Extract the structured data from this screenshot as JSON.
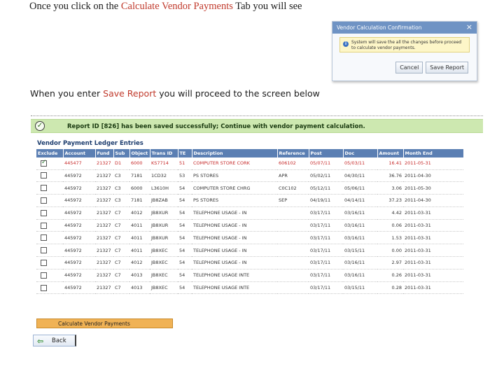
{
  "intro": {
    "prefix": "Once you click on the ",
    "highlight": "Calculate Vendor Payments",
    "suffix": " Tab you will see"
  },
  "dialog": {
    "title": "Vendor Calculation Confirmation",
    "close": "×",
    "message": "System will save the all the changes before proceed to calculate vendor payments.",
    "cancel_label": "Cancel",
    "save_label": "Save Report"
  },
  "intro2": {
    "prefix": "When you enter ",
    "highlight": "Save Report",
    "suffix": " you will proceed to the  screen below"
  },
  "success": {
    "text": "Report ID [826] has been saved successfully; Continue with vendor payment calculation."
  },
  "ledger": {
    "title": "Vendor Payment Ledger Entries",
    "columns": [
      "Exclude",
      "Account",
      "Fund",
      "Sub",
      "Object",
      "Trans ID",
      "TE",
      "Description",
      "Reference",
      "Post",
      "Doc",
      "Amount",
      "Month End"
    ],
    "rows": [
      {
        "checked": true,
        "account": "445477",
        "fund": "21327",
        "sub": "D1",
        "object": "6000",
        "trans_id": "KS7714",
        "te": "51",
        "description": "COMPUTER STORE CORK",
        "reference": "606102",
        "post": "05/07/11",
        "doc": "05/03/11",
        "amount": "16.41",
        "month_end": "2011-05-31"
      },
      {
        "checked": false,
        "account": "445972",
        "fund": "21327",
        "sub": "C3",
        "object": "7181",
        "trans_id": "1CD32",
        "te": "53",
        "description": "PS STORES",
        "reference": "APR",
        "post": "05/02/11",
        "doc": "04/30/11",
        "amount": "36.76",
        "month_end": "2011-04-30"
      },
      {
        "checked": false,
        "account": "445972",
        "fund": "21327",
        "sub": "C3",
        "object": "6000",
        "trans_id": "L3610H",
        "te": "54",
        "description": "COMPUTER STORE CHRG",
        "reference": "C0C102",
        "post": "05/12/11",
        "doc": "05/06/11",
        "amount": "3.06",
        "month_end": "2011-05-30"
      },
      {
        "checked": false,
        "account": "445972",
        "fund": "21327",
        "sub": "C3",
        "object": "7181",
        "trans_id": "JB8ZAB",
        "te": "54",
        "description": "PS STORES",
        "reference": "SEP",
        "post": "04/19/11",
        "doc": "04/14/11",
        "amount": "37.23",
        "month_end": "2011-04-30"
      },
      {
        "checked": false,
        "account": "445972",
        "fund": "21327",
        "sub": "C7",
        "object": "4012",
        "trans_id": "JB8XUR",
        "te": "54",
        "description": "TELEPHONE USAGE - IN",
        "reference": "",
        "post": "03/17/11",
        "doc": "03/16/11",
        "amount": "4.42",
        "month_end": "2011-03-31"
      },
      {
        "checked": false,
        "account": "445972",
        "fund": "21327",
        "sub": "C7",
        "object": "4011",
        "trans_id": "JB8XUR",
        "te": "54",
        "description": "TELEPHONE USAGE - IN",
        "reference": "",
        "post": "03/17/11",
        "doc": "03/16/11",
        "amount": "0.06",
        "month_end": "2011-03-31"
      },
      {
        "checked": false,
        "account": "445972",
        "fund": "21327",
        "sub": "C7",
        "object": "4011",
        "trans_id": "JB8XUR",
        "te": "54",
        "description": "TELEPHONE USAGE - IN",
        "reference": "",
        "post": "03/17/11",
        "doc": "03/16/11",
        "amount": "1.53",
        "month_end": "2011-03-31"
      },
      {
        "checked": false,
        "account": "445972",
        "fund": "21327",
        "sub": "C7",
        "object": "4011",
        "trans_id": "JB8XEC",
        "te": "54",
        "description": "TELEPHONE USAGE - IN",
        "reference": "",
        "post": "03/17/11",
        "doc": "03/15/11",
        "amount": "0.00",
        "month_end": "2011-03-31"
      },
      {
        "checked": false,
        "account": "445972",
        "fund": "21327",
        "sub": "C7",
        "object": "4012",
        "trans_id": "JB8XEC",
        "te": "54",
        "description": "TELEPHONE USAGE - IN",
        "reference": "",
        "post": "03/17/11",
        "doc": "03/16/11",
        "amount": "2.97",
        "month_end": "2011-03-31"
      },
      {
        "checked": false,
        "account": "445972",
        "fund": "21327",
        "sub": "C7",
        "object": "4013",
        "trans_id": "JB8XEC",
        "te": "54",
        "description": "TELEPHONE USAGE INTE",
        "reference": "",
        "post": "03/17/11",
        "doc": "03/16/11",
        "amount": "0.26",
        "month_end": "2011-03-31"
      },
      {
        "checked": false,
        "account": "445972",
        "fund": "21327",
        "sub": "C7",
        "object": "4013",
        "trans_id": "JB8XEC",
        "te": "54",
        "description": "TELEPHONE USAGE INTE",
        "reference": "",
        "post": "03/17/11",
        "doc": "03/15/11",
        "amount": "0.28",
        "month_end": "2011-03-31"
      }
    ]
  },
  "buttons": {
    "calculate_label": "Calculate Vendor Payments",
    "back_label": "Back"
  },
  "colors": {
    "accent_red": "#c0392b",
    "header_blue": "#5b7fb3",
    "success_green": "#cde8b0",
    "button_orange": "#f0b255"
  }
}
